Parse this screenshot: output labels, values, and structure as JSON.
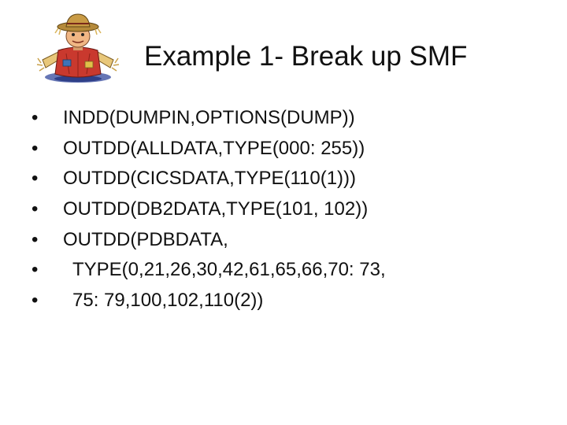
{
  "slide": {
    "title": "Example 1- Break up SMF",
    "logo_icon": "scarecrow-clipart-icon",
    "bullet_glyph": "•",
    "bullets": [
      "INDD(DUMPIN,OPTIONS(DUMP))",
      "OUTDD(ALLDATA,TYPE(000: 255))",
      "OUTDD(CICSDATA,TYPE(110(1)))",
      "OUTDD(DB2DATA,TYPE(101, 102))",
      "OUTDD(PDBDATA,",
      "TYPE(0,21,26,30,42,61,65,66,70: 73,",
      "75: 79,100,102,110(2))"
    ]
  }
}
